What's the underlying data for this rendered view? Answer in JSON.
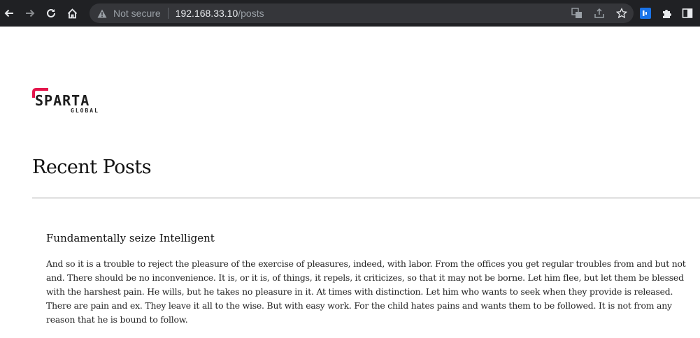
{
  "browser": {
    "security_label": "Not secure",
    "url_host": "192.168.33.10",
    "url_path": "/posts"
  },
  "logo": {
    "brand": "SPARTA",
    "sub": "GLOBAL",
    "accent_color": "#e4154b"
  },
  "page": {
    "title": "Recent Posts"
  },
  "posts": [
    {
      "title": "Fundamentally seize Intelligent",
      "body": "And so it is a trouble to reject the pleasure of the exercise of pleasures, indeed, with labor. From the offices you get regular troubles from and but not and. There should be no inconvenience. It is, or it is, of things, it repels, it criticizes, so that it may not be borne. Let him flee, but let them be blessed with the harshest pain. He wills, but he takes no pleasure in it. At times with distinction. Let him who wants to seek when they provide is released. There are pain and ex. They leave it all to the wise. But with easy work. For the child hates pains and wants them to be followed. It is not from any reason that he is bound to follow."
    }
  ]
}
